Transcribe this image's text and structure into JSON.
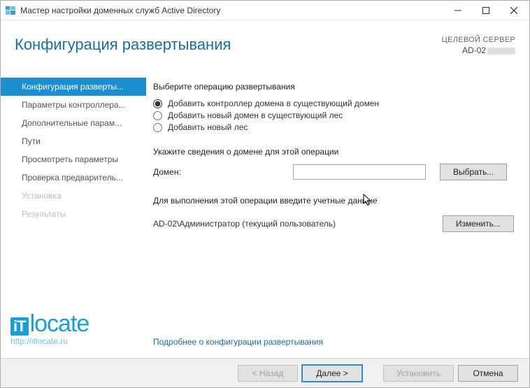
{
  "window": {
    "title": "Мастер настройки доменных служб Active Directory"
  },
  "header": {
    "page_title": "Конфигурация развертывания",
    "target_label": "ЦЕЛЕВОЙ СЕРВЕР",
    "target_server": "AD-02"
  },
  "sidebar": {
    "items": [
      {
        "label": "Конфигурация разверты...",
        "state": "selected"
      },
      {
        "label": "Параметры контроллера...",
        "state": "normal"
      },
      {
        "label": "Дополнительные парам...",
        "state": "normal"
      },
      {
        "label": "Пути",
        "state": "normal"
      },
      {
        "label": "Просмотреть параметры",
        "state": "normal"
      },
      {
        "label": "Проверка предваритель...",
        "state": "normal"
      },
      {
        "label": "Установка",
        "state": "disabled"
      },
      {
        "label": "Результаты",
        "state": "disabled"
      }
    ]
  },
  "content": {
    "op_heading": "Выберите операцию развертывания",
    "radios": [
      {
        "label": "Добавить контроллер домена в существующий домен",
        "checked": true
      },
      {
        "label": "Добавить новый домен в существующий лес",
        "checked": false
      },
      {
        "label": "Добавить новый лес",
        "checked": false
      }
    ],
    "domain_heading": "Укажите сведения о домене для этой операции",
    "domain_label": "Домен:",
    "domain_value": "",
    "select_button": "Выбрать...",
    "cred_heading": "Для выполнения этой операции введите учетные данные",
    "cred_user": "AD-02\\Администратор (текущий пользователь)",
    "change_button": "Изменить...",
    "more_link": "Подробнее о конфигурации развертывания"
  },
  "watermark": {
    "text": "locate",
    "prefix": "iT",
    "url": "http://itlocate.ru"
  },
  "footer": {
    "back": "< Назад",
    "next": "Далее >",
    "install": "Установить",
    "cancel": "Отмена"
  }
}
